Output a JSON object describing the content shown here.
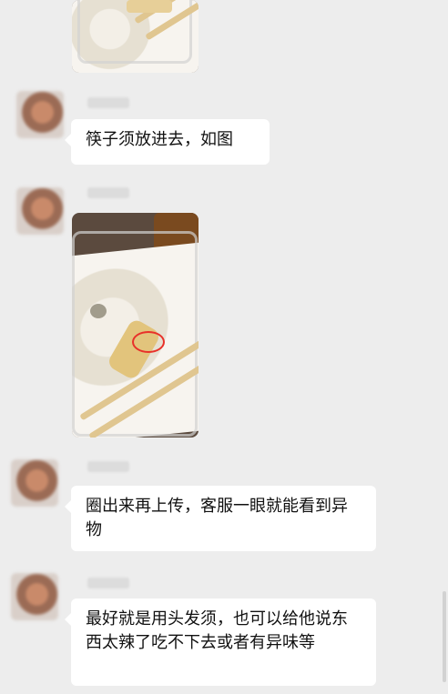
{
  "messages": [
    {
      "type": "image",
      "description_icon": "photo-rice-box-top"
    },
    {
      "type": "text",
      "text": "筷子须放进去，如图"
    },
    {
      "type": "image",
      "description_icon": "photo-rice-box-circled"
    },
    {
      "type": "text",
      "text": "圈出来再上传，客服一眼就能看到异物"
    },
    {
      "type": "text",
      "text": "最好就是用头发须，也可以给他说东西太辣了吃不下去或者有异味等"
    }
  ],
  "colors": {
    "background": "#ededed",
    "bubble": "#ffffff",
    "annotation_circle": "#e8312a"
  }
}
